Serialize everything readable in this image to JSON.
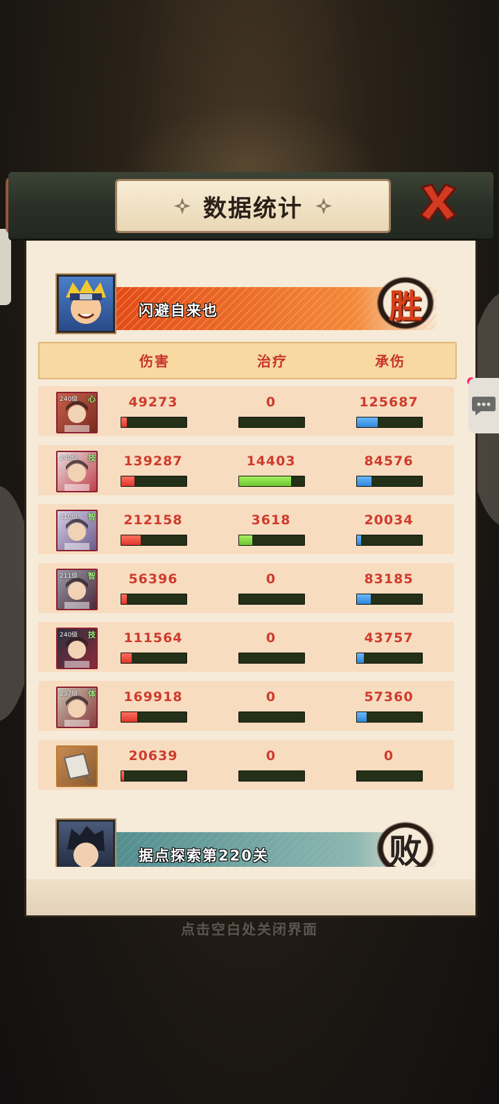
{
  "dialog": {
    "title": "数据统计",
    "close_label": "X"
  },
  "winner": {
    "name": "闪避自来也",
    "result": "胜"
  },
  "loser": {
    "name": "据点探索第220关",
    "result": "败"
  },
  "table": {
    "headers": [
      "伤害",
      "治疗",
      "承伤"
    ],
    "rows": [
      {
        "level": "240级",
        "attr": "心",
        "damage": "49273",
        "heal": "0",
        "taken": "125687",
        "damage_fill": 0.08,
        "heal_fill": 0,
        "taken_fill": 0.32
      },
      {
        "level": "240级",
        "attr": "技",
        "damage": "139287",
        "heal": "14403",
        "taken": "84576",
        "damage_fill": 0.2,
        "heal_fill": 0.8,
        "taken_fill": 0.22
      },
      {
        "level": "210级",
        "attr": "智",
        "damage": "212158",
        "heal": "3618",
        "taken": "20034",
        "damage_fill": 0.3,
        "heal_fill": 0.2,
        "taken_fill": 0.06
      },
      {
        "level": "211级",
        "attr": "智",
        "damage": "56396",
        "heal": "0",
        "taken": "83185",
        "damage_fill": 0.08,
        "heal_fill": 0,
        "taken_fill": 0.21
      },
      {
        "level": "240级",
        "attr": "技",
        "damage": "111564",
        "heal": "0",
        "taken": "43757",
        "damage_fill": 0.16,
        "heal_fill": 0,
        "taken_fill": 0.11
      },
      {
        "level": "237级",
        "attr": "体",
        "damage": "169918",
        "heal": "0",
        "taken": "57360",
        "damage_fill": 0.24,
        "heal_fill": 0,
        "taken_fill": 0.15
      },
      {
        "level": "",
        "attr": "",
        "damage": "20639",
        "heal": "0",
        "taken": "0",
        "damage_fill": 0.04,
        "heal_fill": 0,
        "taken_fill": 0
      }
    ]
  },
  "hint": "点击空白处关闭界面",
  "colors": {
    "damage": "#e0352a",
    "heal": "#6cc630",
    "taken": "#2f86d8",
    "accent": "#cf3b2c"
  }
}
